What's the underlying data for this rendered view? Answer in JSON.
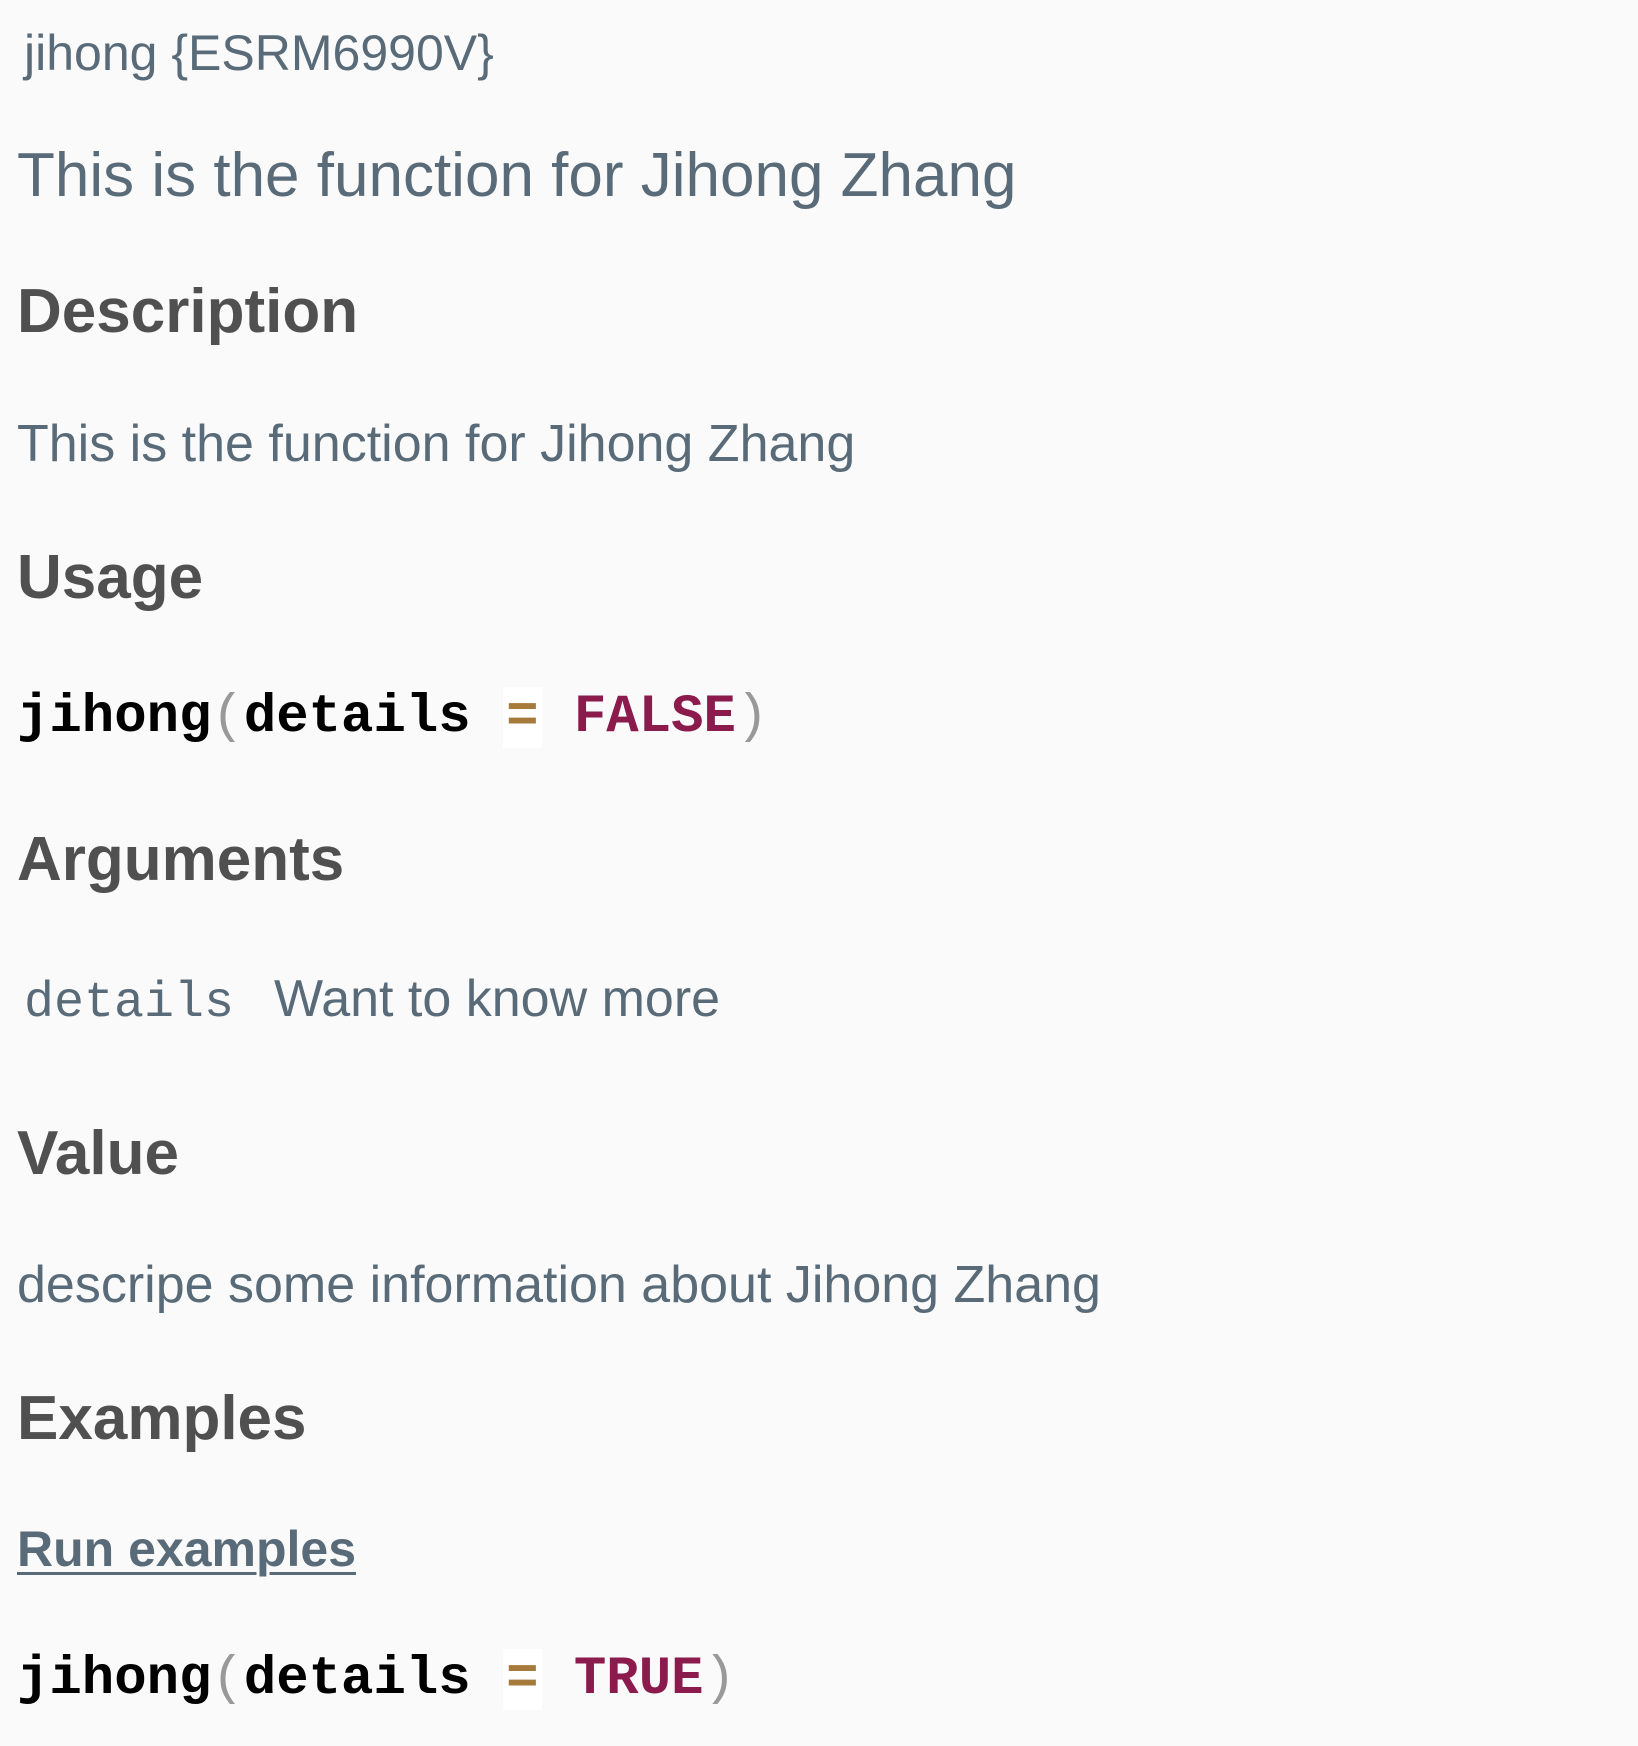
{
  "header": {
    "name": "jihong",
    "package": "{ESRM6990V}"
  },
  "title": "This is the function for Jihong Zhang",
  "sections": {
    "description": {
      "heading": "Description",
      "text": "This is the function for Jihong Zhang"
    },
    "usage": {
      "heading": "Usage",
      "code": {
        "fn": "jihong",
        "open": "(",
        "arg": "details",
        "op": "=",
        "value": "FALSE",
        "close": ")"
      }
    },
    "arguments": {
      "heading": "Arguments",
      "items": [
        {
          "name": "details",
          "desc": "Want to know more"
        }
      ]
    },
    "value": {
      "heading": "Value",
      "text": "descripe some information about Jihong Zhang"
    },
    "examples": {
      "heading": "Examples",
      "run_link": "Run examples",
      "code": {
        "fn": "jihong",
        "open": "(",
        "arg": "details",
        "op": "=",
        "value": "TRUE",
        "close": ")"
      }
    }
  },
  "colors": {
    "background": "#fafafa",
    "text": "#596b78",
    "heading": "#505050",
    "keyword": "#8b1a4d",
    "operator": "#a57a3a"
  }
}
